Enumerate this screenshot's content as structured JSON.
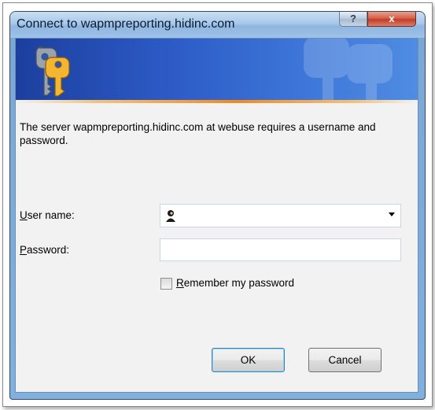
{
  "window": {
    "title": "Connect to wapmpreporting.hidinc.com",
    "help_glyph": "?",
    "close_glyph": "x"
  },
  "banner": {
    "icon": "keys-icon",
    "watermark_icon": "keys-watermark-icon",
    "accent_color": "#f08a1c"
  },
  "dialog": {
    "message": "The server wapmpreporting.hidinc.com at webuse requires a username and password.",
    "username": {
      "label_accesskey": "U",
      "label_rest": "ser name:",
      "value": "",
      "icon": "user-icon"
    },
    "password": {
      "label_accesskey": "P",
      "label_rest": "assword:",
      "value": ""
    },
    "remember": {
      "label_accesskey": "R",
      "label_rest": "emember my password",
      "checked": false
    },
    "buttons": {
      "ok_label": "OK",
      "cancel_label": "Cancel"
    }
  }
}
